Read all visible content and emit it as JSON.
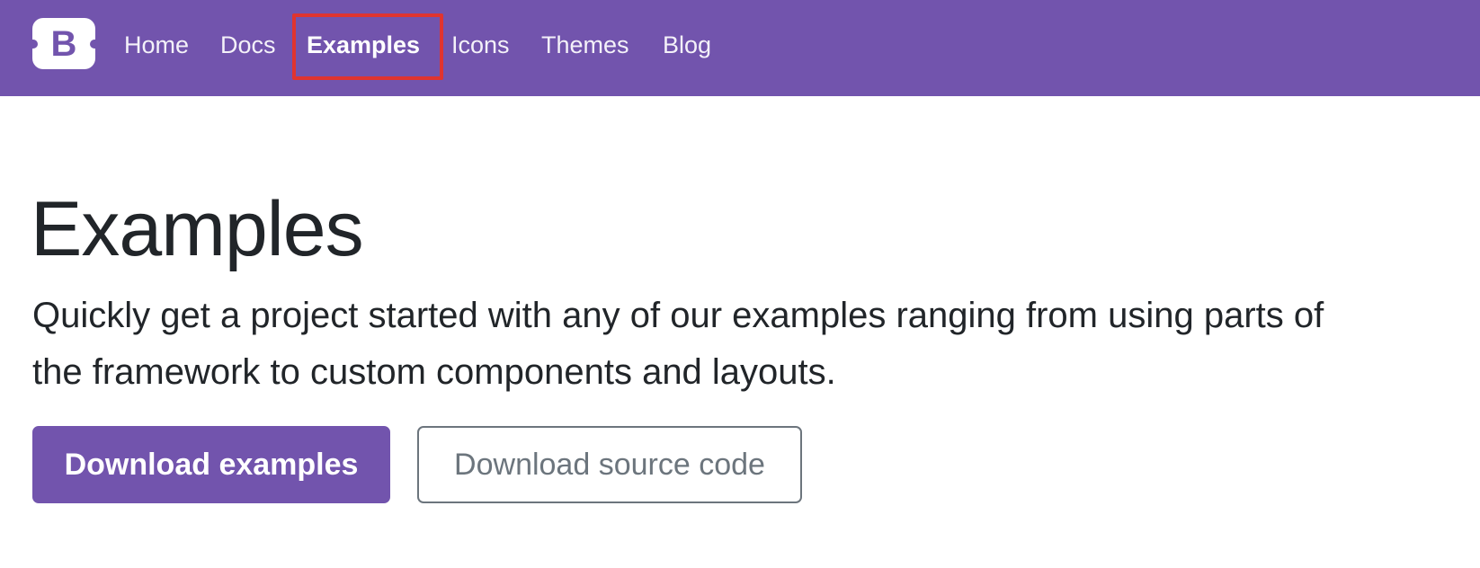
{
  "navbar": {
    "brand_letter": "B",
    "links": [
      {
        "label": "Home"
      },
      {
        "label": "Docs"
      },
      {
        "label": "Examples",
        "active": true
      },
      {
        "label": "Icons"
      },
      {
        "label": "Themes"
      },
      {
        "label": "Blog"
      }
    ],
    "background_color": "#7254ad",
    "highlight_color": "#e0342f"
  },
  "hero": {
    "title": "Examples",
    "lead_line1": "Quickly get a project started with any of our examples ranging from using parts of",
    "lead_line2": "the framework to custom components and layouts.",
    "primary_button": "Download examples",
    "secondary_button": "Download source code"
  }
}
